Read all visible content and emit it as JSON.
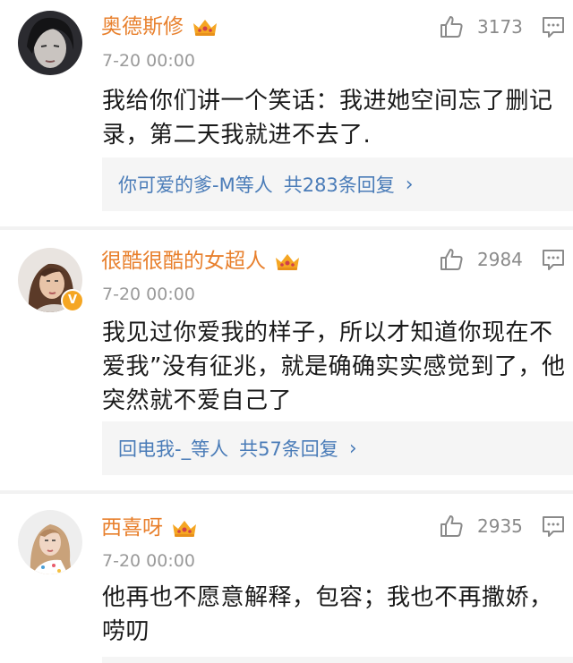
{
  "comments": [
    {
      "username": "奥德斯修",
      "time": "7-20 00:00",
      "likes": "3173",
      "text": "我给你们讲一个笑话：我进她空间忘了删记录，第二天我就进不去了.",
      "replies": {
        "who": "你可爱的爹-M等人",
        "count": "共283条回复"
      },
      "verified": false
    },
    {
      "username": "很酷很酷的女超人",
      "time": "7-20 00:00",
      "likes": "2984",
      "text": "我见过你爱我的样子，所以才知道你现在不爱我”没有征兆，就是确确实实感觉到了，他突然就不爱自己了",
      "replies": {
        "who": "回电我-_等人",
        "count": "共57条回复"
      },
      "verified": true
    },
    {
      "username": "西喜呀",
      "time": "7-20 00:00",
      "likes": "2935",
      "text": "他再也不愿意解释，包容；我也不再撒娇，唠叨",
      "verified": false
    }
  ],
  "icons": {
    "like": "thumbs-up-icon",
    "comment": "comment-icon",
    "crown": "vip-crown-icon",
    "chevron": "chevron-right-icon",
    "verified": "verified-badge-icon"
  },
  "colors": {
    "username": "#e8802d",
    "reply_link": "#4a7cb8",
    "crown": "#f5a623",
    "verified": "#f5a623"
  },
  "chevron_glyph": "›",
  "verified_glyph": "V"
}
